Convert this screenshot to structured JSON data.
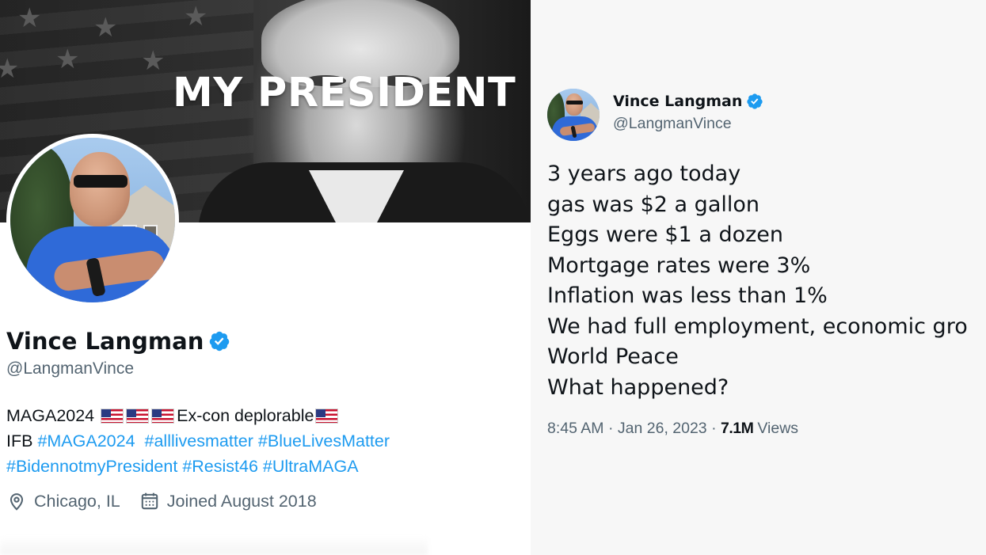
{
  "profile": {
    "banner_text": "MY PRESIDENT",
    "display_name": "Vince Langman",
    "handle": "@LangmanVince",
    "bio": {
      "line1_start": "MAGA2024",
      "line1_end": "Ex-con deplorable",
      "line2_prefix": "IFB",
      "line2_hashtags": [
        "#MAGA2024",
        "#alllivesmatter",
        "#BlueLivesMatter"
      ],
      "line3_hashtags": [
        "#BidennotmyPresident",
        "#Resist46",
        "#UltraMAGA"
      ]
    },
    "location": "Chicago, IL",
    "joined": "Joined August 2018"
  },
  "tweet": {
    "display_name": "Vince Langman",
    "handle": "@LangmanVince",
    "lines": [
      "3 years ago today",
      "gas was $2 a gallon",
      "Eggs were $1 a dozen",
      "Mortgage rates were 3%",
      "Inflation was less than 1%",
      "We had full employment, economic gro",
      "World Peace",
      "What happened?"
    ],
    "time": "8:45 AM",
    "date": "Jan 26, 2023",
    "views_count": "7.1M",
    "views_label": "Views",
    "separator": "·"
  },
  "colors": {
    "link": "#1d9bf0",
    "secondary_text": "#536471",
    "primary_text": "#0f1419",
    "verified": "#1d9bf0"
  },
  "icons": {
    "verified": "verified-badge-icon",
    "location": "location-pin-icon",
    "calendar": "calendar-icon",
    "flag": "us-flag-emoji"
  }
}
